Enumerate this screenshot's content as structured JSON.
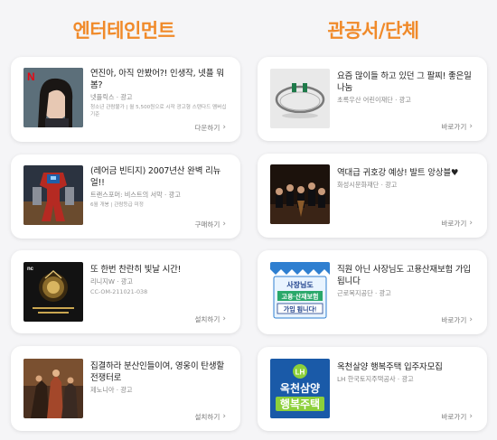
{
  "columns": {
    "left_title": "엔터테인먼트",
    "right_title": "관공서/단체"
  },
  "left_cards": [
    {
      "title": "연진아, 아직 안봤어?! 인생작, 넷플 뭐 봄?",
      "source": "넷플릭스 · 광고",
      "note": "청소년 관람불가 | 월 5,500원으로 시작 광고형 스탠다드 멤버십 기준",
      "cta": "다운하기",
      "thumb_icon": "actress-portrait-netflix-thumbnail"
    },
    {
      "title": "(레어금 빈티지) 2007년산 완벽 리뉴얼!!",
      "source": "트랜스포머: 비스트의 서막 · 광고",
      "note": "6월 개봉 | 관람등급 미정",
      "cta": "구매하기",
      "thumb_icon": "transformers-robot-thumbnail"
    },
    {
      "title": "또 한번 찬란히 빛날 시간!",
      "source": "리니지W · 광고",
      "note": "CC-OM-211021-038",
      "cta": "설치하기",
      "thumb_icon": "lineage-coupon-thumbnail"
    },
    {
      "title": "집결하라 분산인들이여, 영웅이 탄생할 전쟁터로",
      "source": "제노니아 · 광고",
      "note": "",
      "cta": "설치하기",
      "thumb_icon": "fantasy-game-heroes-thumbnail"
    }
  ],
  "right_cards": [
    {
      "title": "요즘 많이들 하고 있던 그 팔찌! 좋은일 나눔",
      "source": "초록우산 어린이재단 · 광고",
      "cta": "바로가기",
      "thumb_icon": "bracelet-thumbnail"
    },
    {
      "title": "역대급 귀호강 예상! 발트 앙상블♥",
      "source": "화성시문화재단 · 광고",
      "cta": "바로가기",
      "thumb_icon": "orchestra-ensemble-thumbnail"
    },
    {
      "title": "직원 아닌 사장님도 고용산재보험 가입됩니다",
      "source": "근로복지공단 · 광고",
      "cta": "바로가기",
      "thumb_icon": "insurance-poster-thumbnail",
      "thumb_text": [
        "사장님도",
        "고용·산재보험",
        "가입 됩니다!"
      ]
    },
    {
      "title": "옥천살양 행복주택 입주자모집",
      "source": "LH 한국토지주택공사 · 광고",
      "cta": "바로가기",
      "thumb_icon": "lh-housing-thumbnail",
      "thumb_text": [
        "LH",
        "옥천삼양",
        "행복주택"
      ]
    }
  ],
  "colors": {
    "accent": "#f08a2a",
    "background": "#f5f5f7",
    "card": "#ffffff"
  }
}
